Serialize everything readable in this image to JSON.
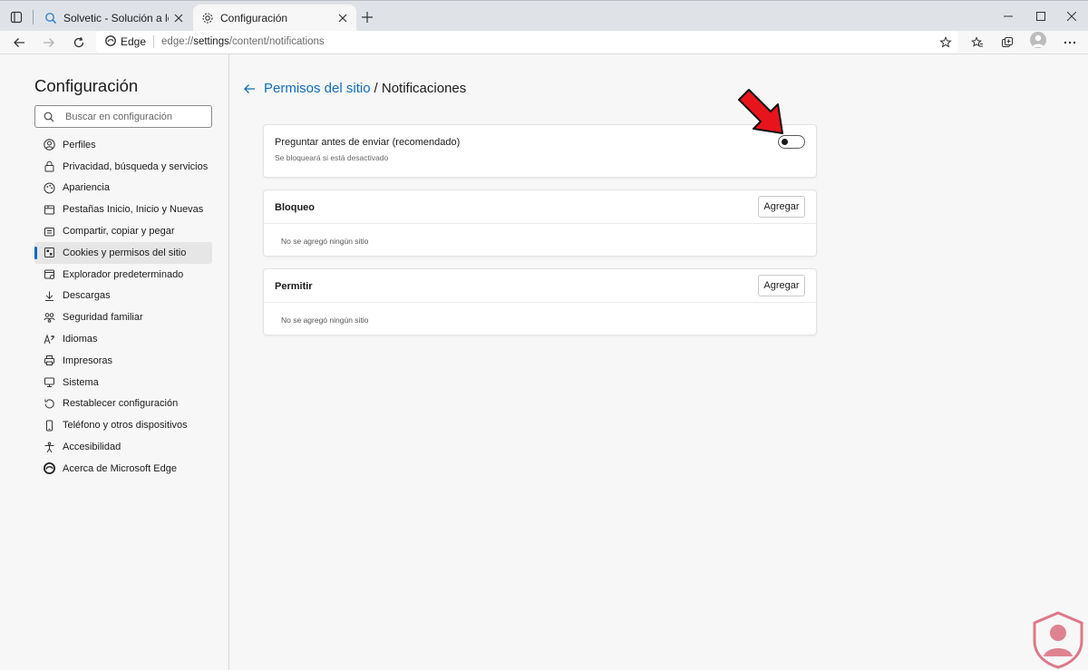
{
  "tabs": [
    {
      "label": "Solvetic - Solución a los problemas informáticos",
      "icon": "search-favicon-icon"
    },
    {
      "label": "Configuración",
      "icon": "gear-icon"
    }
  ],
  "address": {
    "chip_label": "Edge",
    "url_prefix": "edge://",
    "url_host": "settings",
    "url_path": "/content/notifications"
  },
  "sidebar": {
    "title": "Configuración",
    "search_placeholder": "Buscar en configuración",
    "items": [
      {
        "label": "Perfiles",
        "icon": "profile-icon"
      },
      {
        "label": "Privacidad, búsqueda y servicios",
        "icon": "lock-icon"
      },
      {
        "label": "Apariencia",
        "icon": "appearance-icon"
      },
      {
        "label": "Pestañas Inicio, Inicio y Nuevas",
        "icon": "tabs-icon"
      },
      {
        "label": "Compartir, copiar y pegar",
        "icon": "share-icon"
      },
      {
        "label": "Cookies y permisos del sitio",
        "icon": "cookies-icon",
        "active": true
      },
      {
        "label": "Explorador predeterminado",
        "icon": "browser-icon"
      },
      {
        "label": "Descargas",
        "icon": "download-icon"
      },
      {
        "label": "Seguridad familiar",
        "icon": "family-icon"
      },
      {
        "label": "Idiomas",
        "icon": "language-icon"
      },
      {
        "label": "Impresoras",
        "icon": "printer-icon"
      },
      {
        "label": "Sistema",
        "icon": "system-icon"
      },
      {
        "label": "Restablecer configuración",
        "icon": "reset-icon"
      },
      {
        "label": "Teléfono y otros dispositivos",
        "icon": "phone-icon"
      },
      {
        "label": "Accesibilidad",
        "icon": "accessibility-icon"
      },
      {
        "label": "Acerca de Microsoft Edge",
        "icon": "edge-logo-icon"
      }
    ]
  },
  "main": {
    "breadcrumb_link": "Permisos del sitio",
    "breadcrumb_current": "/ Notificaciones",
    "ask_card": {
      "title": "Preguntar antes de enviar (recomendado)",
      "subtitle": "Se bloqueará si está desactivado",
      "toggle_on": false
    },
    "block_card": {
      "title": "Bloqueo",
      "button": "Agregar",
      "empty": "No se agregó ningún sitio"
    },
    "allow_card": {
      "title": "Permitir",
      "button": "Agregar",
      "empty": "No se agregó ningún sitio"
    }
  },
  "colors": {
    "accent": "#0f6cbd",
    "arrow": "#e8141c",
    "watermark": "#c8102e"
  }
}
